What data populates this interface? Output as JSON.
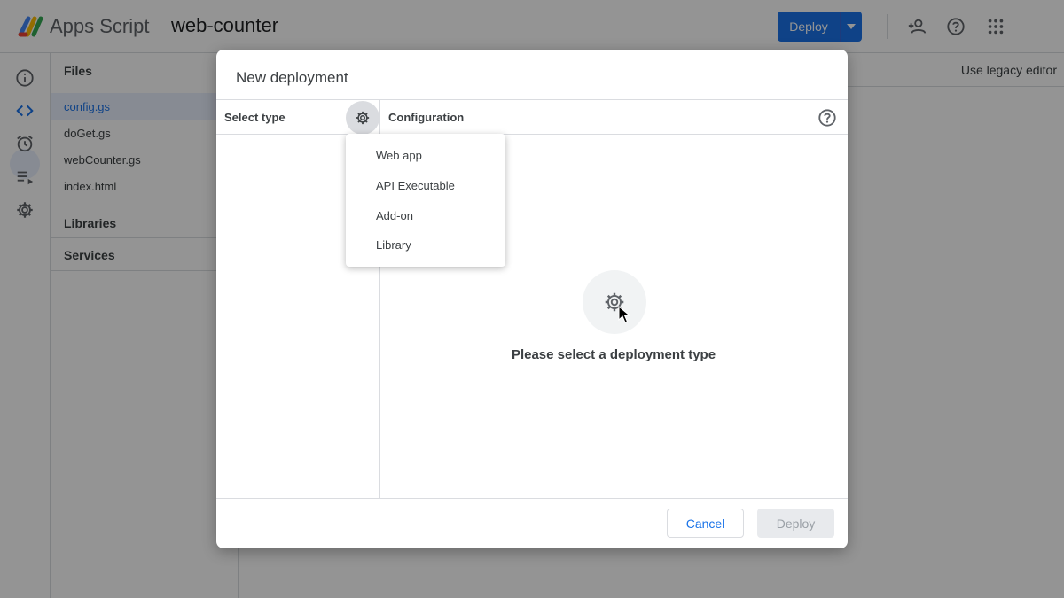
{
  "app": {
    "name": "Apps Script",
    "project_name": "web-counter",
    "deploy_label": "Deploy",
    "legacy_editor_label": "Use legacy editor"
  },
  "rail": {
    "icons": [
      "info-icon",
      "code-icon",
      "alarm-icon",
      "executions-icon",
      "gear-icon"
    ],
    "active": "code-icon"
  },
  "files_panel": {
    "files_header": "Files",
    "files": [
      "config.gs",
      "doGet.gs",
      "webCounter.gs",
      "index.html"
    ],
    "active_file": "config.gs",
    "libraries_header": "Libraries",
    "services_header": "Services"
  },
  "dialog": {
    "title": "New deployment",
    "select_type_label": "Select type",
    "configuration_label": "Configuration",
    "placeholder_text": "Please select a deployment type",
    "cancel_label": "Cancel",
    "deploy_label": "Deploy"
  },
  "type_menu": {
    "items": [
      "Web app",
      "API Executable",
      "Add-on",
      "Library"
    ]
  },
  "colors": {
    "accent": "#1a73e8",
    "active_bg": "#e8f0fe",
    "border": "#dadce0",
    "text": "#3c4043"
  }
}
